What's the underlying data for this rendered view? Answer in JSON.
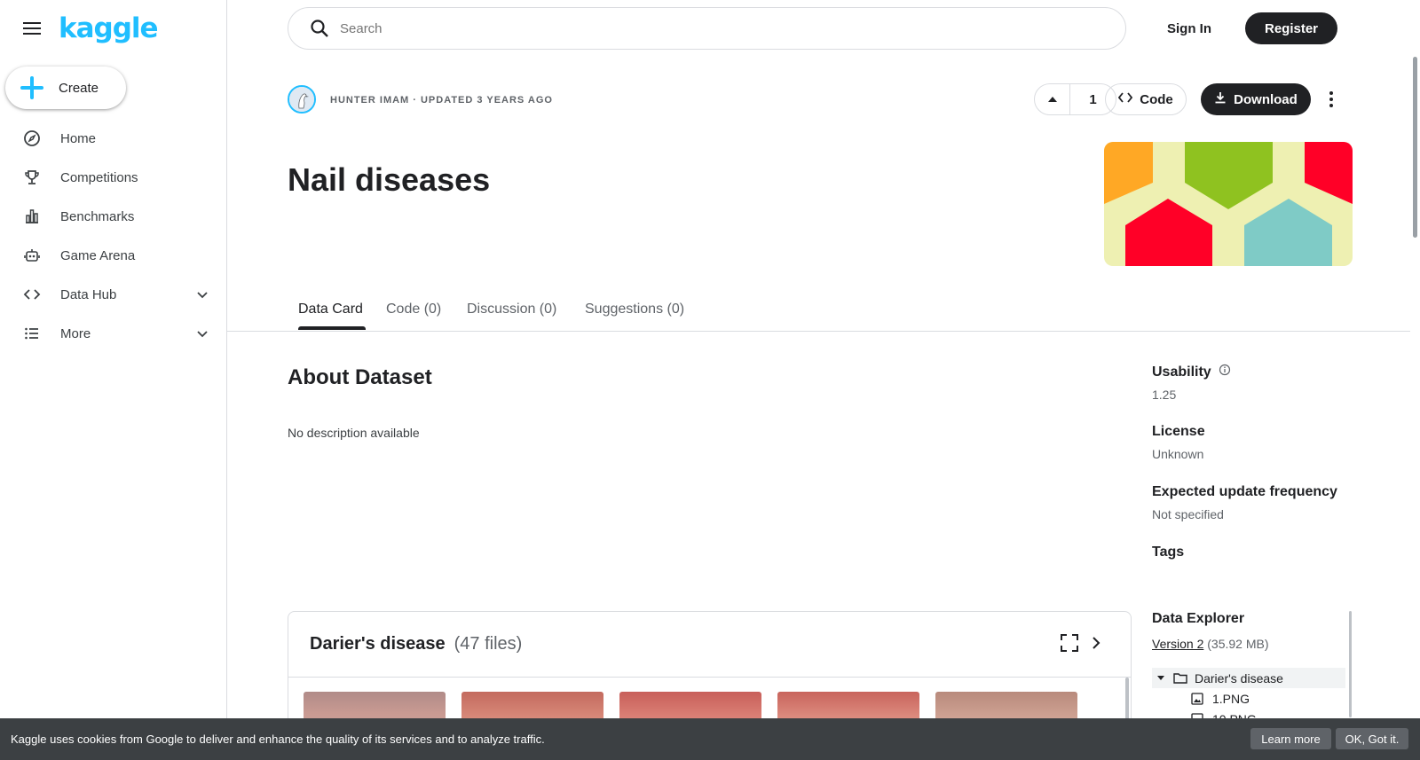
{
  "app": {
    "logo_text": "kaggle",
    "accent_color": "#20beff"
  },
  "sidebar": {
    "create_label": "Create",
    "items": [
      {
        "label": "Home",
        "icon": "compass-icon"
      },
      {
        "label": "Competitions",
        "icon": "trophy-icon"
      },
      {
        "label": "Benchmarks",
        "icon": "bar-chart-icon"
      },
      {
        "label": "Game Arena",
        "icon": "robot-icon"
      },
      {
        "label": "Data Hub",
        "icon": "code-brackets-icon",
        "expandable": true
      },
      {
        "label": "More",
        "icon": "list-icon",
        "expandable": true
      }
    ]
  },
  "topbar": {
    "search_placeholder": "Search",
    "signin_label": "Sign In",
    "register_label": "Register"
  },
  "dataset": {
    "author_line": "HUNTER IMAM · UPDATED 3 YEARS AGO",
    "upvotes": "1",
    "code_label": "Code",
    "download_label": "Download",
    "title": "Nail diseases",
    "thumbnail_colors": [
      "#ffa825",
      "#8fc220",
      "#ff0027",
      "#7fcbc6",
      "#eef0b2"
    ]
  },
  "tabs": [
    {
      "label": "Data Card",
      "active": true
    },
    {
      "label": "Code (0)",
      "active": false
    },
    {
      "label": "Discussion (0)",
      "active": false
    },
    {
      "label": "Suggestions (0)",
      "active": false
    }
  ],
  "about": {
    "title": "About Dataset",
    "description": "No description available"
  },
  "info": {
    "usability_label": "Usability",
    "usability_value": "1.25",
    "license_label": "License",
    "license_value": "Unknown",
    "frequency_label": "Expected update frequency",
    "frequency_value": "Not specified",
    "tags_label": "Tags"
  },
  "files_panel": {
    "folder_name": "Darier's disease",
    "file_count": "(47 files)"
  },
  "data_explorer": {
    "title": "Data Explorer",
    "version_link": "Version 2",
    "size": "(35.92 MB)",
    "tree": [
      {
        "label": "Darier's disease",
        "type": "folder"
      },
      {
        "label": "1.PNG",
        "type": "file"
      },
      {
        "label": "10.PNG",
        "type": "file"
      }
    ]
  },
  "cookie_banner": {
    "text": "Kaggle uses cookies from Google to deliver and enhance the quality of its services and to analyze traffic.",
    "learn_more": "Learn more",
    "ok": "OK, Got it."
  }
}
